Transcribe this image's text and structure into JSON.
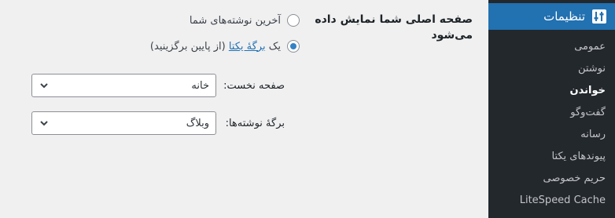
{
  "sidebar": {
    "header_label": "تنظیمات",
    "items": [
      {
        "label": "عمومی"
      },
      {
        "label": "نوشتن"
      },
      {
        "label": "خواندن"
      },
      {
        "label": "گفت‌وگو"
      },
      {
        "label": "رسانه"
      },
      {
        "label": "پیوندهای یکتا"
      },
      {
        "label": "حریم خصوصی"
      },
      {
        "label": "LiteSpeed Cache"
      }
    ],
    "current_index": 2,
    "colors": {
      "background": "#23282d",
      "active": "#2271b1",
      "text": "#c3c4c7"
    }
  },
  "reading": {
    "section_label_line1": "صفحه اصلی شما نمایش داده",
    "section_label_line2": "می‌شود",
    "options": [
      {
        "label": "آخرین نوشته‌های شما",
        "selected": false
      },
      {
        "prefix": "یک",
        "link": "برگهٔ یکتا",
        "suffix": "(از پایین برگزینید)",
        "selected": true
      }
    ],
    "homepage_label": "صفحه نخست:",
    "homepage_value": "خانه",
    "postspage_label": "برگهٔ نوشته‌ها:",
    "postspage_value": "وبلاگ"
  }
}
